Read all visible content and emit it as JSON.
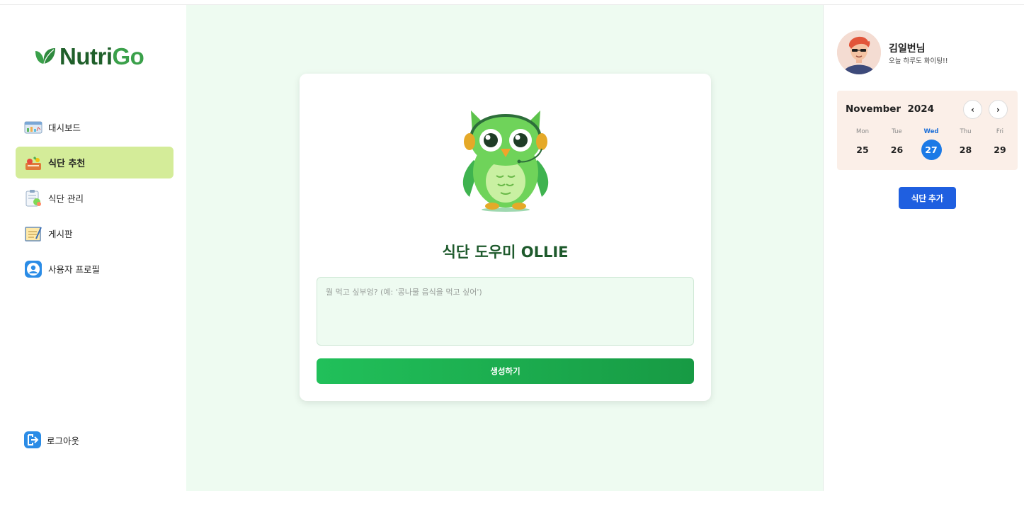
{
  "brand": {
    "name_part1": "Nutri",
    "name_part2": "Go"
  },
  "sidebar": {
    "items": [
      {
        "label": "대시보드",
        "icon": "dashboard-icon",
        "active": false
      },
      {
        "label": "식단 추천",
        "icon": "meal-recommend-icon",
        "active": true
      },
      {
        "label": "식단 관리",
        "icon": "meal-manage-icon",
        "active": false
      },
      {
        "label": "게시판",
        "icon": "board-icon",
        "active": false
      },
      {
        "label": "사용자 프로필",
        "icon": "user-profile-icon",
        "active": false
      }
    ],
    "logout_label": "로그아웃"
  },
  "main": {
    "title": "식단 도우미 OLLIE",
    "input_placeholder": "뭘 먹고 싶부엉? (예: '콩나물 음식을 먹고 싶어')",
    "generate_label": "생성하기"
  },
  "user": {
    "name": "김일번님",
    "greeting": "오늘 하루도 화이팅!!"
  },
  "calendar": {
    "month": "November",
    "year": "2024",
    "prev": "‹",
    "next": "›",
    "days": [
      {
        "name": "Mon",
        "date": "25"
      },
      {
        "name": "Tue",
        "date": "26"
      },
      {
        "name": "Wed",
        "date": "27"
      },
      {
        "name": "Thu",
        "date": "28"
      },
      {
        "name": "Fri",
        "date": "29"
      }
    ],
    "selected_date": "27"
  },
  "add_meal_label": "식단 추가",
  "colors": {
    "active_nav": "#d4ec99",
    "accent_green": "#21c05a",
    "accent_blue": "#1c7ae6",
    "main_bg": "#eefbf1"
  }
}
